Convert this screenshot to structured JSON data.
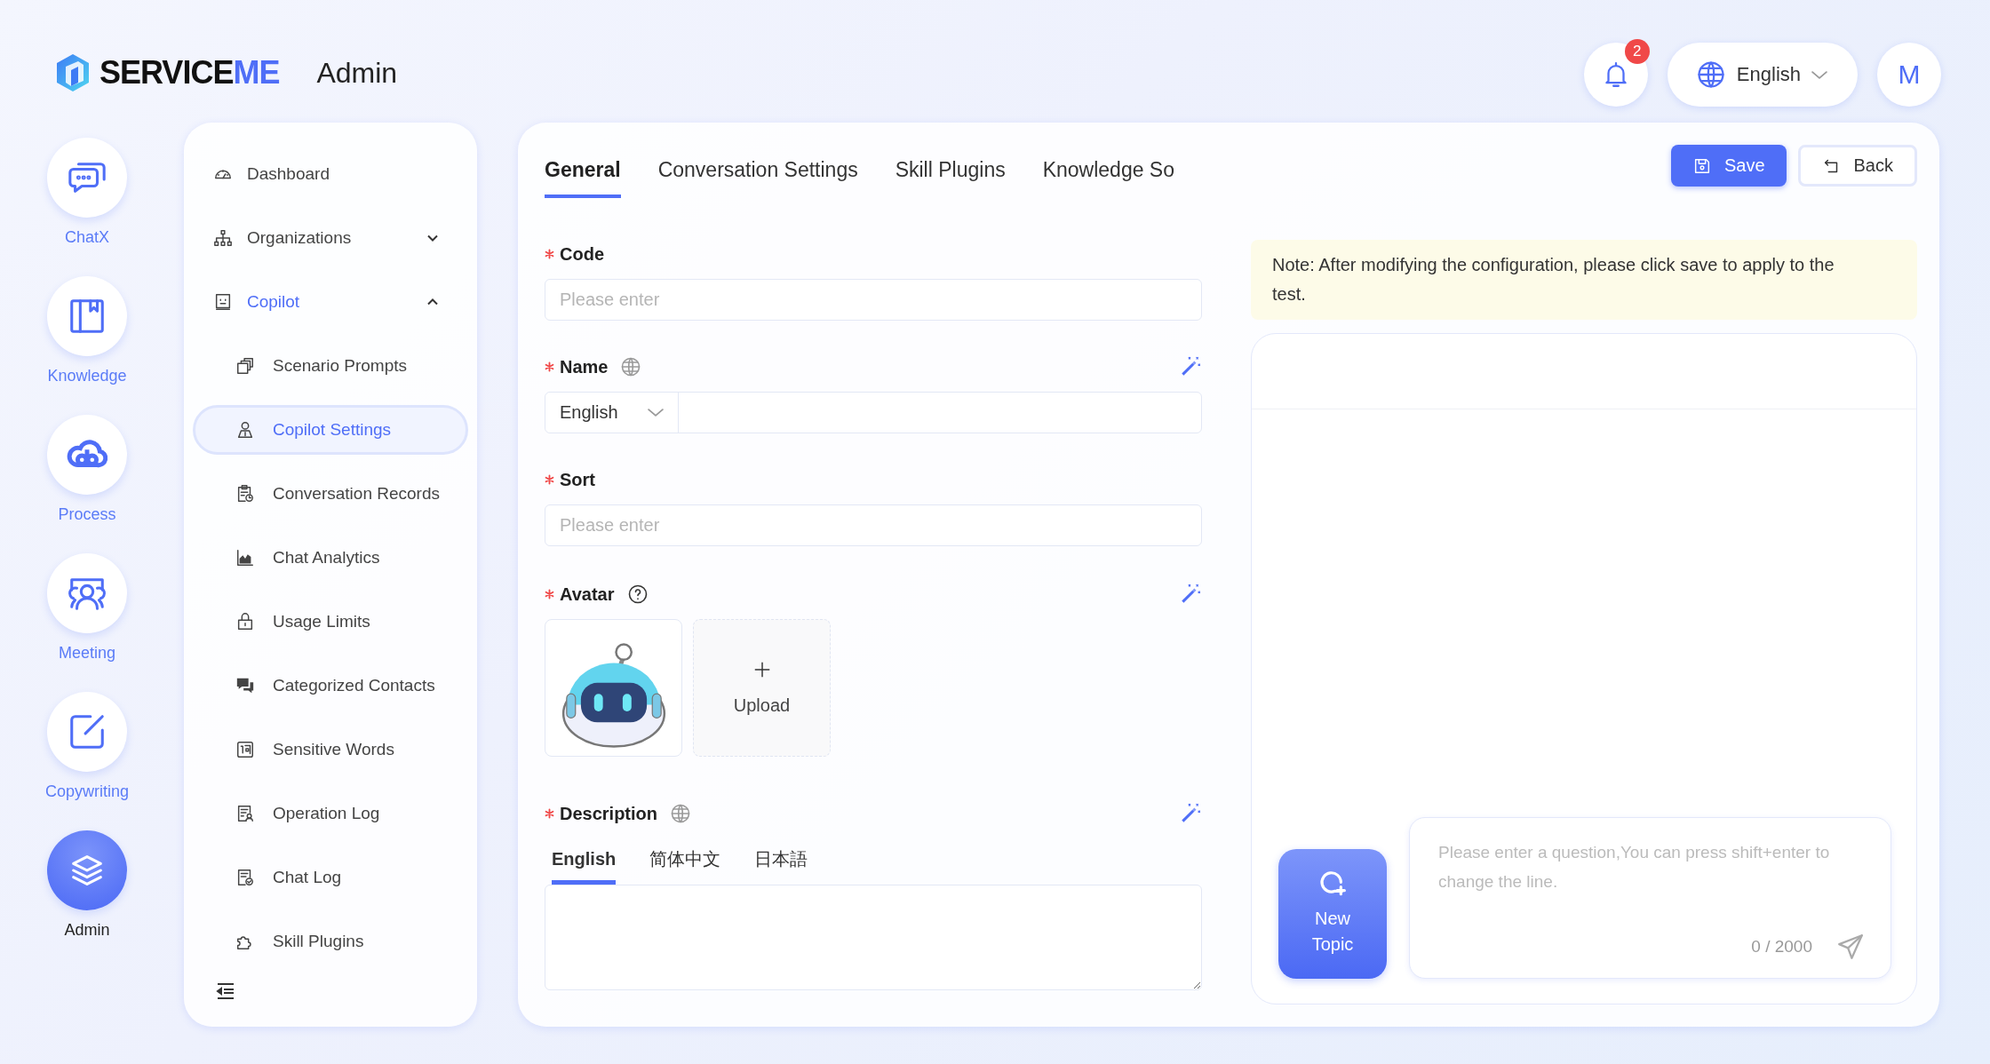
{
  "logo": {
    "text": "SERVICE",
    "accent": "ME"
  },
  "header": {
    "title": "Admin",
    "notifications": "2",
    "language": "English",
    "user_initial": "M"
  },
  "app_rail": [
    {
      "label": "ChatX",
      "selected": false
    },
    {
      "label": "Knowledge",
      "selected": false
    },
    {
      "label": "Process",
      "selected": false
    },
    {
      "label": "Meeting",
      "selected": false
    },
    {
      "label": "Copywriting",
      "selected": false
    },
    {
      "label": "Admin",
      "selected": true
    }
  ],
  "sidebar": {
    "items": [
      {
        "label": "Dashboard",
        "selected": false
      },
      {
        "label": "Organizations",
        "selected": false,
        "expanded": false
      },
      {
        "label": "Copilot",
        "selected": false,
        "expanded": true,
        "children": [
          {
            "label": "Scenario Prompts",
            "selected": false
          },
          {
            "label": "Copilot Settings",
            "selected": true
          },
          {
            "label": "Conversation Records",
            "selected": false
          },
          {
            "label": "Chat Analytics",
            "selected": false
          },
          {
            "label": "Usage Limits",
            "selected": false
          },
          {
            "label": "Categorized Contacts",
            "selected": false
          },
          {
            "label": "Sensitive Words",
            "selected": false
          },
          {
            "label": "Operation Log",
            "selected": false
          },
          {
            "label": "Chat Log",
            "selected": false
          },
          {
            "label": "Skill Plugins",
            "selected": false
          }
        ]
      }
    ]
  },
  "tabs": [
    {
      "label": "General",
      "selected": true
    },
    {
      "label": "Conversation Settings",
      "selected": false
    },
    {
      "label": "Skill Plugins",
      "selected": false
    },
    {
      "label": "Knowledge So",
      "selected": false
    }
  ],
  "actions": [
    {
      "label": "Save",
      "kind": "primary"
    },
    {
      "label": "Back",
      "kind": "default"
    }
  ],
  "form": {
    "fields": [
      {
        "kind": "text",
        "label": "Code",
        "required": true,
        "placeholder": "Please enter"
      },
      {
        "kind": "localized-text",
        "label": "Name",
        "required": true,
        "translatable": true,
        "ai_assist": true,
        "language": "English"
      },
      {
        "kind": "text",
        "label": "Sort",
        "required": true,
        "placeholder": "Please enter"
      },
      {
        "kind": "avatar",
        "label": "Avatar",
        "required": true,
        "help": true,
        "ai_assist": true,
        "upload_label": "Upload"
      },
      {
        "kind": "localized-textarea",
        "label": "Description",
        "required": true,
        "translatable": true,
        "ai_assist": true,
        "languages": [
          {
            "label": "English",
            "selected": true
          },
          {
            "label": "简体中文",
            "selected": false
          },
          {
            "label": "日本語",
            "selected": false
          }
        ]
      }
    ]
  },
  "preview": {
    "note": "Note: After modifying the configuration, please click save to apply to the test.",
    "new_topic": "New Topic",
    "input": {
      "placeholder": "Please enter a question,You can press shift+enter to change the line.",
      "counter": "0 / 2000"
    }
  }
}
